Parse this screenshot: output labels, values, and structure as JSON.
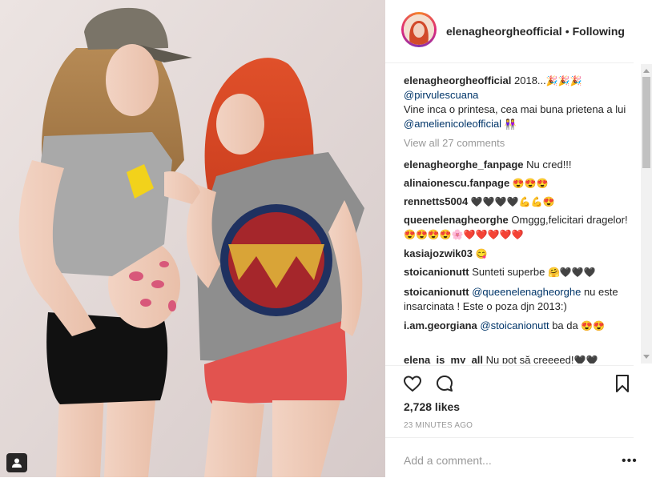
{
  "post": {
    "username": "elenagheorgheofficial",
    "follow_status": "Following",
    "separator": "•"
  },
  "caption": {
    "username": "elenagheorgheofficial",
    "text_1": "2018...",
    "emoji_1": "🎉🎉🎉",
    "mention_1": "@pirvulescuana",
    "text_2": "Vine inca o printesa, cea mai buna prietena a lui",
    "mention_2": "@amelienicoleofficial",
    "emoji_2": "👭"
  },
  "view_all": "View all 27 comments",
  "comments": [
    {
      "user": "elenagheorghe_fanpage",
      "text": "Nu cred!!!",
      "emoji": ""
    },
    {
      "user": "alinaionescu.fanpage",
      "text": "",
      "emoji": "😍😍😍"
    },
    {
      "user": "rennetts5004",
      "text": "",
      "emoji": "🖤🖤🖤🖤💪💪😍"
    },
    {
      "user": "queenelenagheorghe",
      "text": "Omggg,felicitari dragelor!",
      "emoji": "😍😍😍😍🌸❤️❤️❤️❤️❤️"
    },
    {
      "user": "kasiajozwik03",
      "text": "",
      "emoji": "😋"
    },
    {
      "user": "stoicanionutt",
      "text": "Sunteti superbe",
      "emoji": "🤗🖤🖤🖤"
    },
    {
      "user": "stoicanionutt",
      "mention": "@queenelenagheorghe",
      "text": "nu este insarcinata ! Este o poza djn 2013:)",
      "emoji": ""
    },
    {
      "user": "i.am.georgiana",
      "mention": "@stoicanionutt",
      "text": "ba da",
      "emoji": "😍😍"
    },
    {
      "user": "elena_is_my_all",
      "text": "Nu pot să creeeed!",
      "emoji": "🖤🖤"
    }
  ],
  "actions": {
    "like_icon": "heart-icon",
    "comment_icon": "comment-icon",
    "save_icon": "bookmark-icon"
  },
  "likes": "2,728 likes",
  "timestamp": "23 MINUTES AGO",
  "add_comment_placeholder": "Add a comment...",
  "more_options": "•••",
  "colors": {
    "mention": "#003569",
    "muted": "#999999",
    "border": "#efefef",
    "text": "#262626"
  }
}
